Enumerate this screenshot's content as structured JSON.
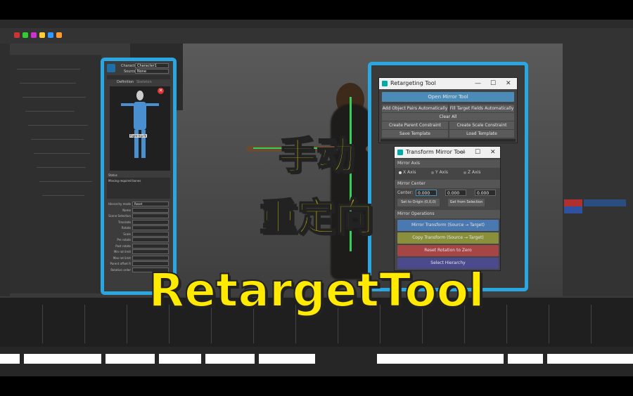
{
  "retarget_window": {
    "title": "Retargeting Tool",
    "controls": [
      "—",
      "☐",
      "✕"
    ],
    "open_mirror": "Open Mirror Tool",
    "rows": [
      [
        "Add Object Pairs Automatically",
        "Fill Target Fields Automatically"
      ],
      [
        "Clear All"
      ],
      [
        "Create Parent Constraint",
        "Create Scale Constraint"
      ],
      [
        "Save Template",
        "Load Template"
      ]
    ]
  },
  "mirror_window": {
    "title": "Transform Mirror Tool",
    "controls": [
      "—",
      "☐",
      "✕"
    ],
    "axis_header": "Mirror Axis",
    "axes": [
      "X Axis",
      "Y Axis",
      "Z Axis"
    ],
    "center_header": "Mirror Center",
    "center_label": "Center:",
    "center_values": [
      "0.000",
      "0.000",
      "0.000"
    ],
    "set_origin": "Set to Origin (0,0,0)",
    "get_selection": "Get from Selection",
    "ops_header": "Mirror Operations",
    "ops": [
      {
        "label": "Mirror Transform (Source → Target)",
        "color": "#4a78b0"
      },
      {
        "label": "Copy Transform (Source → Target)",
        "color": "#8a8f3c"
      },
      {
        "label": "Reset Rotation to Zero",
        "color": "#a64545"
      },
      {
        "label": "Select Hierarchy",
        "color": "#4a4a8c"
      }
    ]
  },
  "hik_panel": {
    "character_label": "Character",
    "character_value": "Character1",
    "source_label": "Source",
    "source_value": "None",
    "tab_definition": "Definition",
    "tab_skeleton": "Skeleton",
    "selected_label": "Right hip fk",
    "status_label": "Status",
    "status_text": "Missing required bones",
    "props": [
      "Hierarchy mode",
      "Name",
      "Scene Selection",
      "Translate",
      "Rotate",
      "Scale",
      "Pre rotate",
      "Post rotate",
      "Min rot limit",
      "Max rot limit",
      "Parent offset R",
      "Rotation order"
    ],
    "hierarchy_value": "Reset"
  },
  "overlay": {
    "line1": "手动",
    "line2": "重定向",
    "line3": "RetargetTool"
  },
  "colors": {
    "frame": "#2aa7e0",
    "overlay_text": "#ffea00"
  }
}
